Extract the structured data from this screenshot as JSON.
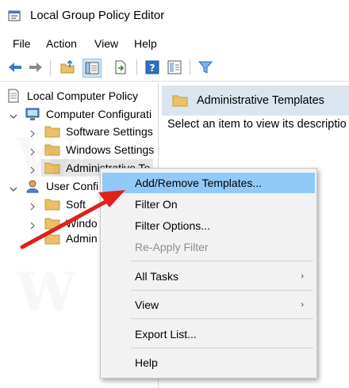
{
  "window": {
    "title": "Local Group Policy Editor"
  },
  "menubar": {
    "items": [
      "File",
      "Action",
      "View",
      "Help"
    ]
  },
  "toolbar": {
    "buttons": [
      "back-icon",
      "forward-icon",
      "up-folder-icon",
      "show-hide-tree-icon",
      "export-list-icon",
      "help-icon",
      "properties-icon",
      "filter-icon"
    ]
  },
  "tree": {
    "root": "Local Computer Policy",
    "computer": "Computer Configurati",
    "computer_children": [
      "Software Settings",
      "Windows Settings",
      "Administrative Te"
    ],
    "user": "User Confi",
    "user_children": [
      "Soft",
      "Windo",
      "Admin"
    ]
  },
  "right_pane": {
    "header": "Administrative Templates",
    "message": "Select an item to view its descriptio"
  },
  "context_menu": {
    "items": [
      {
        "label": "Add/Remove Templates...",
        "highlighted": true
      },
      {
        "label": "Filter On"
      },
      {
        "label": "Filter Options..."
      },
      {
        "label": "Re-Apply Filter",
        "disabled": true
      },
      {
        "label": "All Tasks",
        "submenu": true
      },
      {
        "label": "View",
        "submenu": true
      },
      {
        "label": "Export List..."
      },
      {
        "label": "Help"
      }
    ]
  },
  "colors": {
    "highlight": "#91c9f7",
    "header_bg": "#dbe5ef",
    "arrow": "#e0201b",
    "folder": "#e8c168"
  }
}
